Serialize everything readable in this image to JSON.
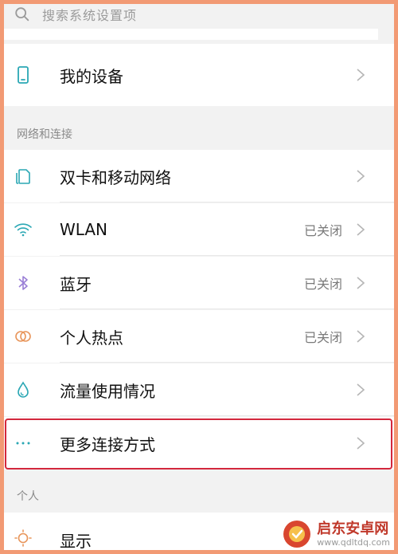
{
  "search": {
    "placeholder": "搜索系统设置项",
    "icon": "search-icon"
  },
  "device": {
    "label": "我的设备",
    "icon": "phone-icon"
  },
  "sections": {
    "network_title": "网络和连接",
    "personal_title": "个人"
  },
  "network_items": [
    {
      "label": "双卡和移动网络",
      "status": "",
      "icon": "dual-sim-icon"
    },
    {
      "label": "WLAN",
      "status": "已关闭",
      "icon": "wifi-icon"
    },
    {
      "label": "蓝牙",
      "status": "已关闭",
      "icon": "bluetooth-icon"
    },
    {
      "label": "个人热点",
      "status": "已关闭",
      "icon": "hotspot-icon"
    },
    {
      "label": "流量使用情况",
      "status": "",
      "icon": "data-usage-icon"
    },
    {
      "label": "更多连接方式",
      "status": "",
      "icon": "more-dots-icon"
    }
  ],
  "personal_items": [
    {
      "label": "显示",
      "icon": "brightness-icon"
    }
  ],
  "watermark": {
    "name": "启东安卓网",
    "url": "www.qdltdq.com"
  },
  "colors": {
    "accent_teal": "#2aa7b4",
    "frame": "#f29a74",
    "highlight": "#d3283d"
  }
}
